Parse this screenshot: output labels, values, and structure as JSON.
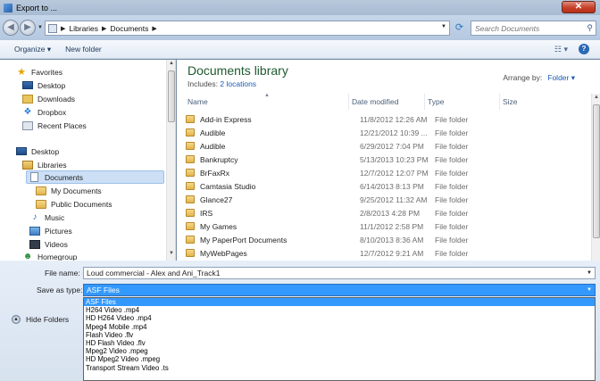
{
  "window": {
    "title": "Export to ..."
  },
  "address": {
    "crumbs": [
      "Libraries",
      "Documents"
    ]
  },
  "search": {
    "placeholder": "Search Documents"
  },
  "toolbar": {
    "organize": "Organize ▾",
    "new_folder": "New folder"
  },
  "nav": {
    "items": [
      {
        "label": "Favorites",
        "icon": "star-icon",
        "indent": 0
      },
      {
        "label": "Desktop",
        "icon": "monitor-icon",
        "indent": 1
      },
      {
        "label": "Downloads",
        "icon": "download-folder-icon",
        "indent": 1
      },
      {
        "label": "Dropbox",
        "icon": "dropbox-icon",
        "indent": 1
      },
      {
        "label": "Recent Places",
        "icon": "recent-places-icon",
        "indent": 1
      },
      {
        "label": "Desktop",
        "icon": "monitor-icon",
        "indent": 0
      },
      {
        "label": "Libraries",
        "icon": "library-icon",
        "indent": 1
      },
      {
        "label": "Documents",
        "icon": "document-icon",
        "indent": 2,
        "selected": true
      },
      {
        "label": "My Documents",
        "icon": "folder-icon",
        "indent": 3
      },
      {
        "label": "Public Documents",
        "icon": "folder-icon",
        "indent": 3
      },
      {
        "label": "Music",
        "icon": "music-icon",
        "indent": 2
      },
      {
        "label": "Pictures",
        "icon": "picture-icon",
        "indent": 2
      },
      {
        "label": "Videos",
        "icon": "video-icon",
        "indent": 2
      },
      {
        "label": "Homegroup",
        "icon": "homegroup-icon",
        "indent": 1
      }
    ]
  },
  "library": {
    "title": "Documents library",
    "includes_label": "Includes:",
    "includes_link": "2 locations",
    "arrange_label": "Arrange by:",
    "arrange_value": "Folder ▾"
  },
  "columns": {
    "name": "Name",
    "date": "Date modified",
    "type": "Type",
    "size": "Size"
  },
  "files": [
    {
      "name": "Add-in Express",
      "date": "11/8/2012 12:26 AM",
      "type": "File folder"
    },
    {
      "name": "Audible",
      "date": "12/21/2012 10:39 ...",
      "type": "File folder"
    },
    {
      "name": "Audible",
      "date": "6/29/2012 7:04 PM",
      "type": "File folder"
    },
    {
      "name": "Bankruptcy",
      "date": "5/13/2013 10:23 PM",
      "type": "File folder"
    },
    {
      "name": "BrFaxRx",
      "date": "12/7/2012 12:07 PM",
      "type": "File folder"
    },
    {
      "name": "Camtasia Studio",
      "date": "6/14/2013 8:13 PM",
      "type": "File folder"
    },
    {
      "name": "Glance27",
      "date": "9/25/2012 11:32 AM",
      "type": "File folder"
    },
    {
      "name": "IRS",
      "date": "2/8/2013 4:28 PM",
      "type": "File folder"
    },
    {
      "name": "My Games",
      "date": "11/1/2012 2:58 PM",
      "type": "File folder"
    },
    {
      "name": "My PaperPort Documents",
      "date": "8/10/2013 8:36 AM",
      "type": "File folder"
    },
    {
      "name": "MyWebPages",
      "date": "12/7/2012 9:21 AM",
      "type": "File folder"
    }
  ],
  "form": {
    "file_name_label": "File name:",
    "file_name_value": "Loud commercial - Alex and Ani_Track1",
    "save_type_label": "Save as type:",
    "save_type_value": "ASF Files",
    "hide_folders": "Hide Folders"
  },
  "type_options": [
    "ASF Files",
    "H264 Video .mp4",
    "HD H264 Video .mp4",
    "Mpeg4 Mobile .mp4",
    "Flash Video .flv",
    "HD Flash Video .flv",
    "Mpeg2 Video .mpeg",
    "HD Mpeg2 Video .mpeg",
    "Transport Stream Video .ts"
  ]
}
